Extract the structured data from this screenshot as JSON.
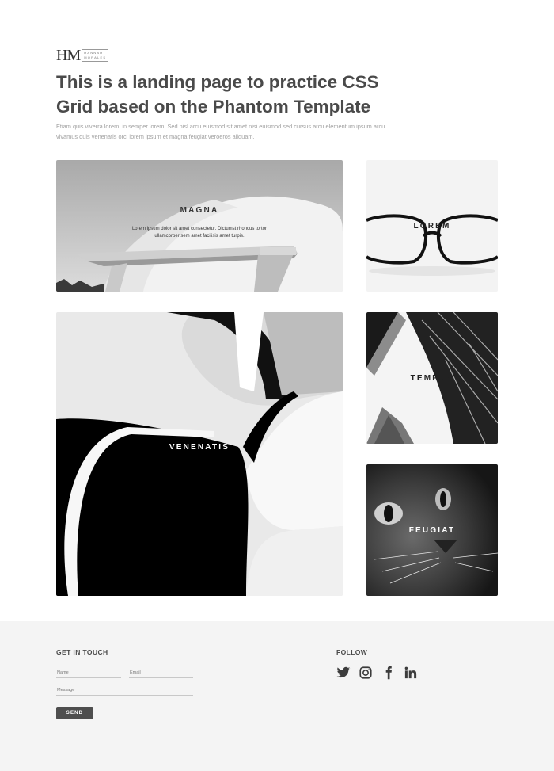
{
  "header": {
    "logo": {
      "mark": "HM",
      "name_line1": "HANNAH",
      "name_line2": "MORALES"
    },
    "title": "This is a landing page to practice CSS Grid based on the Phantom Template",
    "intro": "Etiam quis viverra lorem, in semper lorem. Sed nisl arcu euismod sit amet nisi euismod sed cursus arcu elementum ipsum arcu vivamus quis venenatis orci lorem ipsum et magna feugiat veroeros aliquam."
  },
  "tiles": [
    {
      "title": "MAGNA",
      "description": "Lorem ipsum dolor sit amet consectetur. Dictumst rhoncus tortor ullamcorper sem amet facilisis amet turpis."
    },
    {
      "title": "LOREM"
    },
    {
      "title": "VENENATIS"
    },
    {
      "title": "TEMPUS"
    },
    {
      "title": "FEUGIAT"
    }
  ],
  "footer": {
    "contact": {
      "heading": "GET IN TOUCH",
      "name_placeholder": "Name",
      "email_placeholder": "Email",
      "message_placeholder": "Message",
      "send_label": "SEND"
    },
    "follow": {
      "heading": "FOLLOW",
      "icons": [
        "twitter-icon",
        "instagram-icon",
        "facebook-icon",
        "linkedin-icon"
      ]
    }
  },
  "colors": {
    "accent": "#4e4e4e",
    "footer_bg": "#f4f4f4",
    "title": "#4a4a4a"
  }
}
